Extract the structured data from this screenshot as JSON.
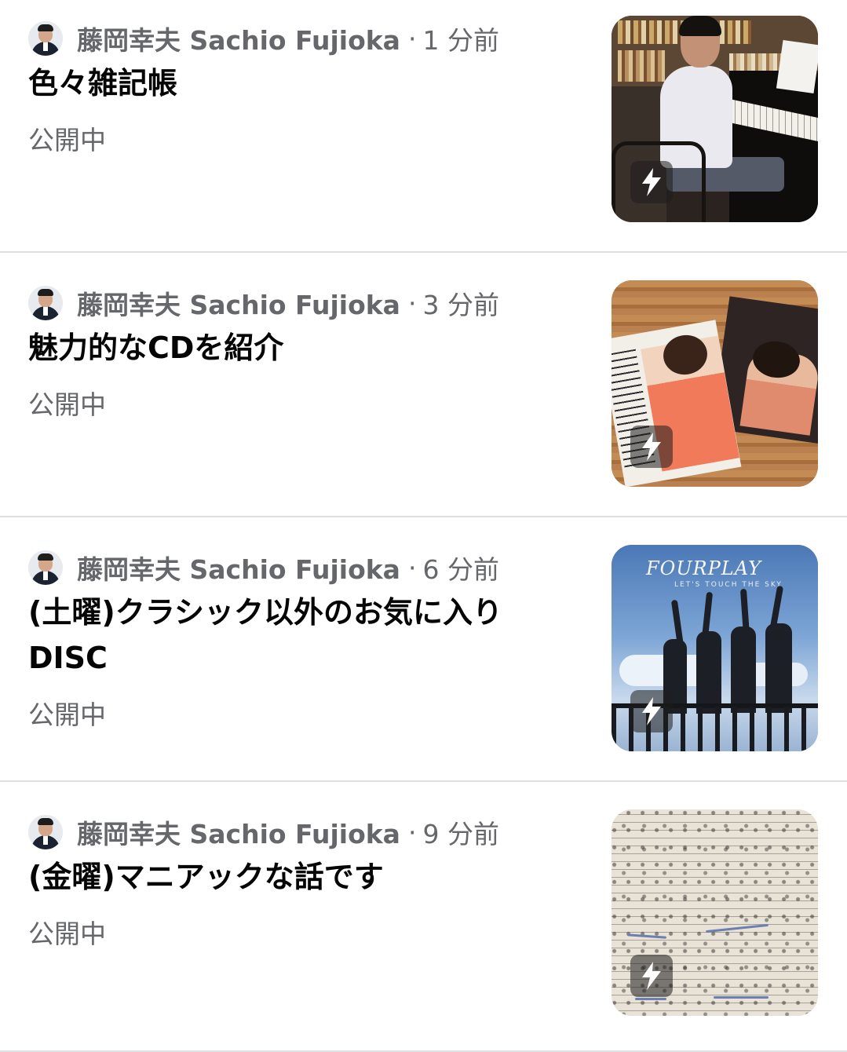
{
  "posts": [
    {
      "author": "藤岡幸夫 Sachio Fujioka",
      "separator": "·",
      "time": "1 分前",
      "title": "色々雑記帳",
      "status": "公開中",
      "thumbnail_icon": "flash-icon"
    },
    {
      "author": "藤岡幸夫 Sachio Fujioka",
      "separator": "·",
      "time": "3 分前",
      "title": "魅力的なCDを紹介",
      "status": "公開中",
      "thumbnail_icon": "flash-icon"
    },
    {
      "author": "藤岡幸夫 Sachio Fujioka",
      "separator": "·",
      "time": "6 分前",
      "title": "(土曜)クラシック以外のお気に入りDISC",
      "status": "公開中",
      "thumbnail_icon": "flash-icon",
      "album_logo": "FOURPLAY",
      "album_sub": "LET'S TOUCH THE SKY"
    },
    {
      "author": "藤岡幸夫 Sachio Fujioka",
      "separator": "·",
      "time": "9 分前",
      "title": "(金曜)マニアックな話です",
      "status": "公開中",
      "thumbnail_icon": "flash-icon"
    }
  ],
  "colors": {
    "meta_text": "#65676b",
    "title_text": "#050505",
    "divider": "#dddfe2",
    "background": "#ffffff"
  }
}
